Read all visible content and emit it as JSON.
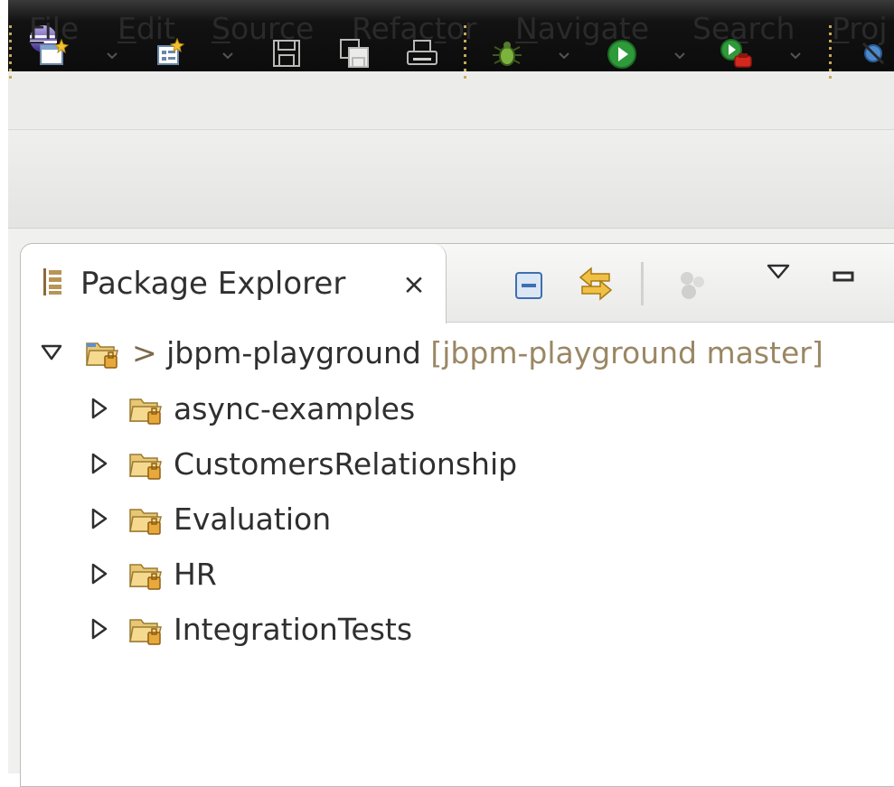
{
  "window": {
    "logo_icon": "eclipse-icon"
  },
  "menu": {
    "items": [
      {
        "pre": "",
        "u": "F",
        "post": "ile"
      },
      {
        "pre": "",
        "u": "E",
        "post": "dit"
      },
      {
        "pre": "",
        "u": "S",
        "post": "ource"
      },
      {
        "pre": "Refac",
        "u": "t",
        "post": "or"
      },
      {
        "pre": "",
        "u": "N",
        "post": "avigate"
      },
      {
        "pre": "Se",
        "u": "a",
        "post": "rch"
      },
      {
        "pre": "",
        "u": "P",
        "post": "roj"
      }
    ]
  },
  "toolbar": {
    "icons": [
      "new-wizard-icon",
      "new-java-class-icon",
      "save-icon",
      "save-all-icon",
      "print-icon",
      "debug-icon",
      "run-icon",
      "external-tools-icon",
      "skip-breakpoints-icon"
    ]
  },
  "package_explorer": {
    "tab_label": "Package Explorer",
    "tab_close": "⨯",
    "view_icons": [
      "collapse-all-icon",
      "link-with-editor-icon",
      "focus-task-icon",
      "view-menu-icon",
      "minimize-icon"
    ],
    "root": {
      "prefix": "> ",
      "name": "jbpm-playground",
      "decoration": " [jbpm-playground master]"
    },
    "children": [
      "async-examples",
      "CustomersRelationship",
      "Evaluation",
      "HR",
      "IntegrationTests"
    ]
  }
}
